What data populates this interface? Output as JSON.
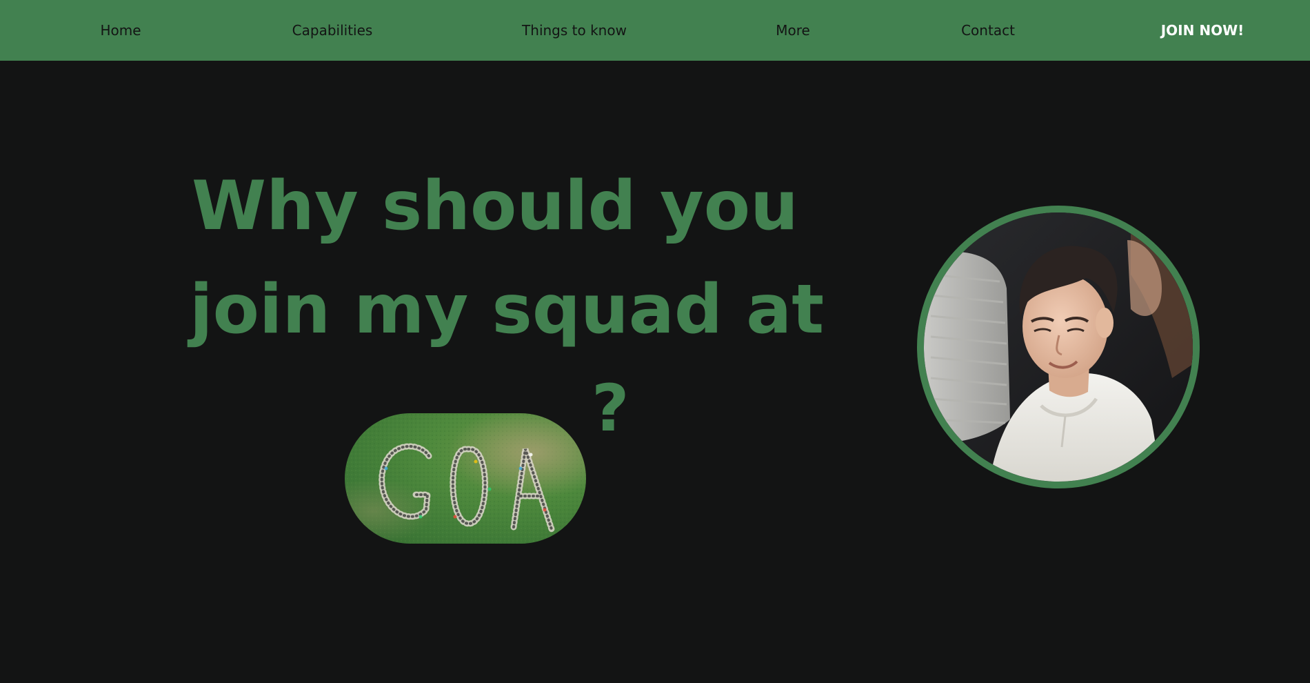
{
  "nav": {
    "items": [
      {
        "label": "Home"
      },
      {
        "label": "Capabilities"
      },
      {
        "label": "Things to know"
      },
      {
        "label": "More"
      },
      {
        "label": "Contact"
      }
    ],
    "cta": "JOIN NOW!"
  },
  "hero": {
    "line1": "Why should you",
    "line2": "join my squad at",
    "question_mark": "?",
    "badge_image_text": "GOA"
  },
  "colors": {
    "accent": "#428150",
    "background": "#131414",
    "nav_text": "#131414",
    "cta_text": "#ffffff"
  },
  "images": {
    "pill": "aerial-photo-people-spelling-goa-on-grass",
    "circle": "photo-boy-white-hoodie-looking-down"
  }
}
